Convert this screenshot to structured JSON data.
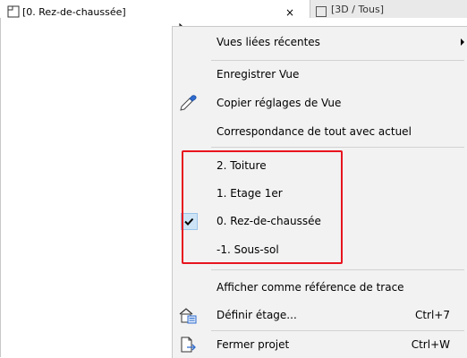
{
  "tabs": {
    "active": {
      "label": "[0. Rez-de-chaussée]",
      "icon": "floor-plan-icon",
      "close_label": "×"
    },
    "inactive": {
      "label": "[3D / Tous]",
      "icon": "3d-window-icon"
    }
  },
  "menu": {
    "items": [
      {
        "label": "Vues liées récentes",
        "has_submenu": true
      },
      {
        "label": "Enregistrer Vue"
      },
      {
        "label": "Copier réglages de Vue",
        "icon": "eyedropper-icon"
      },
      {
        "label": "Correspondance de tout avec actuel"
      },
      {
        "label": "2. Toiture"
      },
      {
        "label": "1. Etage 1er"
      },
      {
        "label": "0. Rez-de-chaussée",
        "checked": true
      },
      {
        "label": "-1. Sous-sol"
      },
      {
        "label": "Afficher comme référence de trace"
      },
      {
        "label": "Définir étage...",
        "shortcut": "Ctrl+7",
        "icon": "define-story-icon"
      },
      {
        "label": "Fermer projet",
        "shortcut": "Ctrl+W",
        "icon": "close-project-icon"
      }
    ]
  },
  "colors": {
    "highlight_border": "#e8141e",
    "checked_background": "#cde4f7",
    "menu_background": "#f2f2f2"
  }
}
